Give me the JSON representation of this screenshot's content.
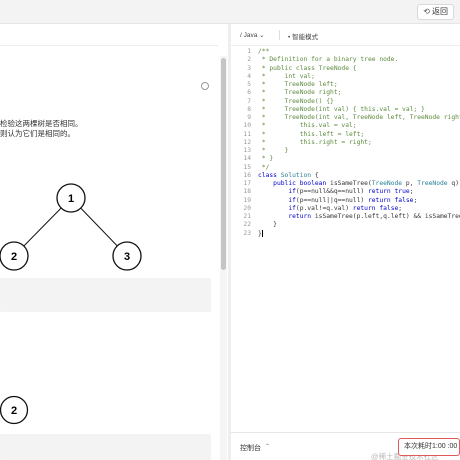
{
  "header": {
    "back_label": "返回",
    "back_icon": "refresh-back-icon"
  },
  "problem": {
    "desc_line_1": "检验这两棵树是否相同。",
    "desc_line_2": "则认为它们是相同的。",
    "tree1": {
      "root": "1",
      "left": "2",
      "right": "3"
    },
    "tree2": {
      "node": "2"
    }
  },
  "editor": {
    "language": "Java",
    "mode": "智能模式",
    "lines": [
      [
        {
          "t": "/**",
          "c": "cm"
        }
      ],
      [
        {
          "t": " * Definition for a binary tree node.",
          "c": "cm"
        }
      ],
      [
        {
          "t": " * public class TreeNode {",
          "c": "cm"
        }
      ],
      [
        {
          "t": " *     int val;",
          "c": "cm"
        }
      ],
      [
        {
          "t": " *     TreeNode left;",
          "c": "cm"
        }
      ],
      [
        {
          "t": " *     TreeNode right;",
          "c": "cm"
        }
      ],
      [
        {
          "t": " *     TreeNode() {}",
          "c": "cm"
        }
      ],
      [
        {
          "t": " *     TreeNode(int val) { this.val = val; }",
          "c": "cm"
        }
      ],
      [
        {
          "t": " *     TreeNode(int val, TreeNode left, TreeNode right) {",
          "c": "cm"
        }
      ],
      [
        {
          "t": " *         this.val = val;",
          "c": "cm"
        }
      ],
      [
        {
          "t": " *         this.left = left;",
          "c": "cm"
        }
      ],
      [
        {
          "t": " *         this.right = right;",
          "c": "cm"
        }
      ],
      [
        {
          "t": " *     }",
          "c": "cm"
        }
      ],
      [
        {
          "t": " * }",
          "c": "cm"
        }
      ],
      [
        {
          "t": " */",
          "c": "cm"
        }
      ],
      [
        {
          "t": "class ",
          "c": "kw"
        },
        {
          "t": "Solution",
          "c": "ty"
        },
        {
          "t": " {",
          "c": "pu"
        }
      ],
      [
        {
          "t": "    public boolean ",
          "c": "kw"
        },
        {
          "t": "isSameTree",
          "c": "pu"
        },
        {
          "t": "(",
          "c": "pu"
        },
        {
          "t": "TreeNode",
          "c": "ty"
        },
        {
          "t": " p, ",
          "c": "pu"
        },
        {
          "t": "TreeNode",
          "c": "ty"
        },
        {
          "t": " q) {",
          "c": "pu"
        }
      ],
      [
        {
          "t": "        if",
          "c": "kw"
        },
        {
          "t": "(p==null&&q==null) ",
          "c": "pu"
        },
        {
          "t": "return true",
          "c": "kw"
        },
        {
          "t": ";",
          "c": "pu"
        }
      ],
      [
        {
          "t": "        if",
          "c": "kw"
        },
        {
          "t": "(p==null||q==null) ",
          "c": "pu"
        },
        {
          "t": "return false",
          "c": "kw"
        },
        {
          "t": ";",
          "c": "pu"
        }
      ],
      [
        {
          "t": "        if",
          "c": "kw"
        },
        {
          "t": "(p.val!=q.val) ",
          "c": "pu"
        },
        {
          "t": "return false",
          "c": "kw"
        },
        {
          "t": ";",
          "c": "pu"
        }
      ],
      [
        {
          "t": "        return ",
          "c": "kw"
        },
        {
          "t": "isSameTree(p.left,q.left) && isSameTree(p.right,q.right);",
          "c": "pu"
        }
      ],
      [
        {
          "t": "    }",
          "c": "pu"
        }
      ],
      [
        {
          "t": "}",
          "c": "pu"
        }
      ]
    ]
  },
  "footer": {
    "console_label": "控制台",
    "run_label": "本次耗时1:00  :00",
    "watermark": "@稀土掘金技术社区"
  },
  "colors": {
    "accent_red": "#e05a5a",
    "comment_green": "#5c8a3c",
    "keyword_blue": "#0000cc"
  }
}
